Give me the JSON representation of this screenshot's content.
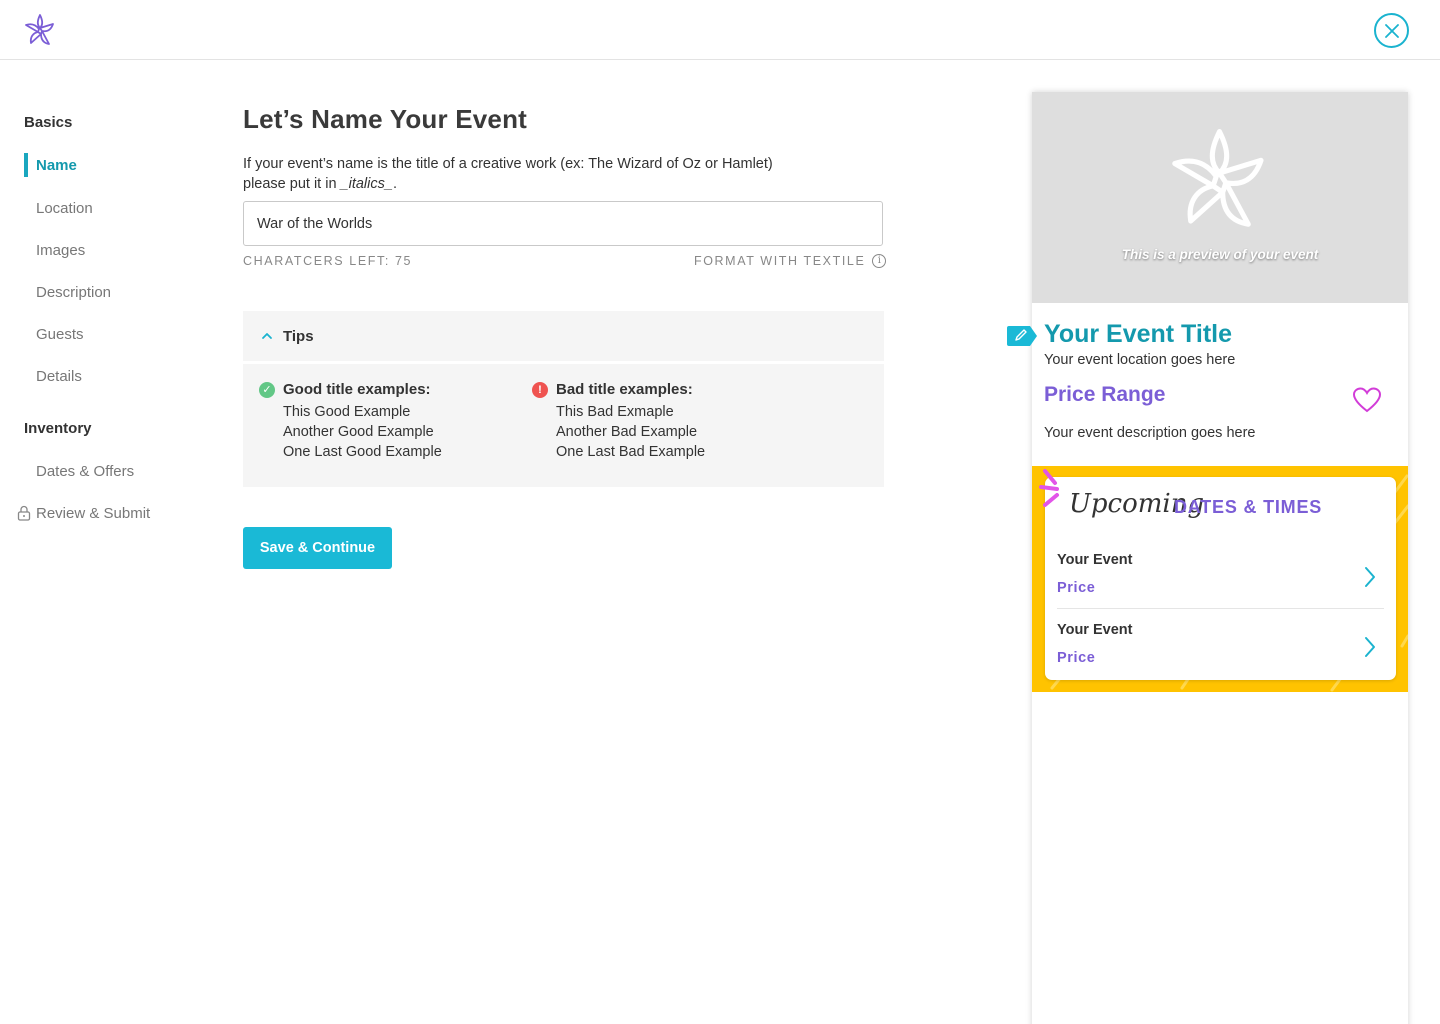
{
  "header": {
    "logo_icon": "star-flower-logo-icon",
    "close_icon": "close-icon",
    "accent": "#1ab3cf"
  },
  "sidebar": {
    "sections": [
      {
        "title": "Basics",
        "items": [
          {
            "label": "Name",
            "active": true
          },
          {
            "label": "Location"
          },
          {
            "label": "Images"
          },
          {
            "label": "Description"
          },
          {
            "label": "Guests"
          },
          {
            "label": "Details"
          }
        ]
      },
      {
        "title": "Inventory",
        "items": [
          {
            "label": "Dates & Offers"
          },
          {
            "label": "Review & Submit",
            "locked": true,
            "icon": "lock-icon"
          }
        ]
      }
    ]
  },
  "main": {
    "title": "Let’s Name Your Event",
    "instructions_line1": "If your event’s name is the title of a creative work (ex: The Wizard of Oz or Hamlet)",
    "instructions_line2_prefix": "please put it in ",
    "instructions_italic": "_italics_",
    "instructions_suffix": ".",
    "name_input_value": "War of the Worlds",
    "chars_left": "CHARATCERS LEFT: 75",
    "format_label": "FORMAT WITH TEXTILE",
    "tips": {
      "title": "Tips",
      "expanded": true,
      "good": {
        "heading": "Good title examples:",
        "color": "#62c786",
        "examples": [
          "This Good Example",
          "Another Good Example",
          "One Last Good Example"
        ]
      },
      "bad": {
        "heading": "Bad title examples:",
        "color": "#ef5350",
        "examples": [
          "This Bad Exmaple",
          "Another Bad Example",
          "One Last Bad Example"
        ]
      }
    },
    "save_button": "Save & Continue"
  },
  "preview": {
    "hero_caption": "This is a preview of your event",
    "event_title": "Your Event Title",
    "event_location": "Your event location goes here",
    "price_range": "Price Range",
    "event_description": "Your event description goes here",
    "upcoming_script": "Upcoming",
    "dates_heading": "DATES & TIMES",
    "dates": [
      {
        "name": "Your Event",
        "price": "Price"
      },
      {
        "name": "Your Event",
        "price": "Price"
      }
    ],
    "colors": {
      "title": "#1499ad",
      "purple": "#7b5ed6",
      "yellow": "#ffc300",
      "heart": "#d23cd8"
    }
  }
}
